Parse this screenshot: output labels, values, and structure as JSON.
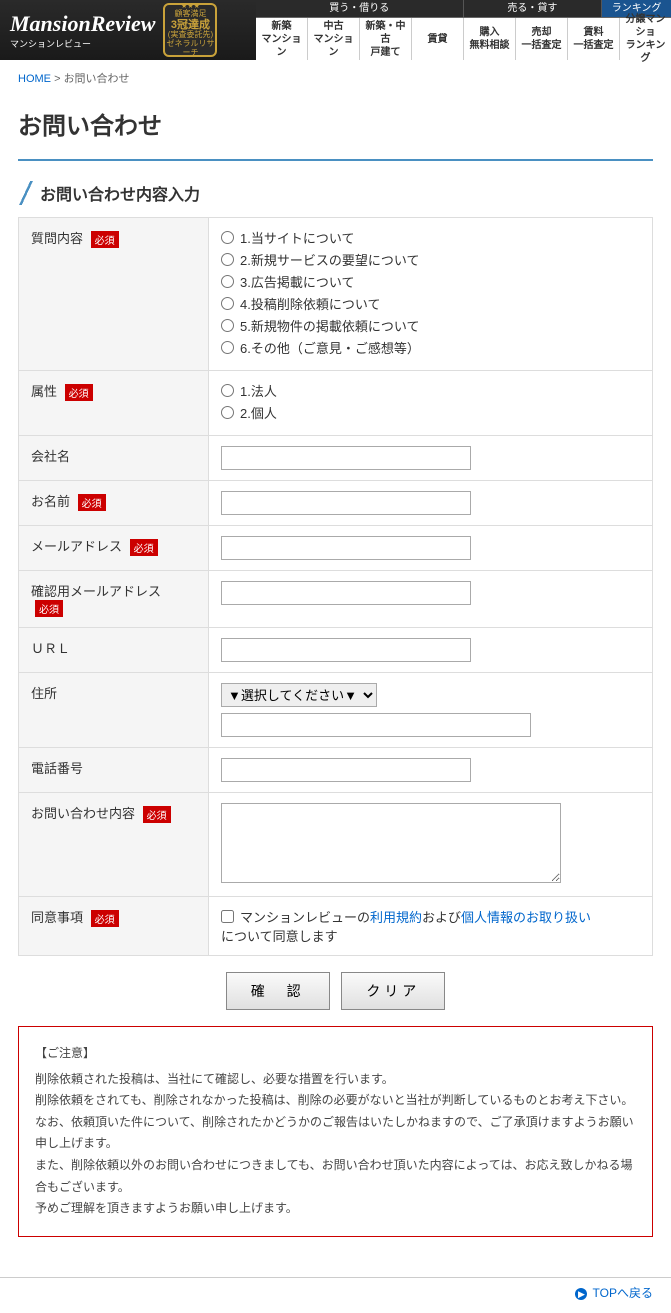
{
  "header": {
    "logo_main": "MansionReview",
    "logo_sub": "マンションレビュー",
    "badge": {
      "stars": "★★★",
      "line1": "顧客満足",
      "main": "3冠達成",
      "line2": "(実査委託先)",
      "line3": "ゼネラルリサーチ"
    }
  },
  "nav": {
    "cats": [
      "買う・借りる",
      "売る・貸す",
      "ランキング"
    ],
    "tabs": [
      "新築\nマンション",
      "中古\nマンション",
      "新築・中古\n戸建て",
      "賃貸",
      "購入\n無料相談",
      "売却\n一括査定",
      "賃料\n一括査定",
      "分譲マンショ\nランキング"
    ]
  },
  "breadcrumb": {
    "home": "HOME",
    "sep": ">",
    "current": "お問い合わせ"
  },
  "page_title": "お問い合わせ",
  "section_title": "お問い合わせ内容入力",
  "required_label": "必須",
  "form": {
    "q_type": {
      "label": "質問内容",
      "required": true,
      "options": [
        "1.当サイトについて",
        "2.新規サービスの要望について",
        "3.広告掲載について",
        "4.投稿削除依頼について",
        "5.新規物件の掲載依頼について",
        "6.その他（ご意見・ご感想等）"
      ]
    },
    "attr": {
      "label": "属性",
      "required": true,
      "options": [
        "1.法人",
        "2.個人"
      ]
    },
    "company": {
      "label": "会社名",
      "required": false
    },
    "name": {
      "label": "お名前",
      "required": true
    },
    "email": {
      "label": "メールアドレス",
      "required": true
    },
    "email_confirm": {
      "label": "確認用メールアドレス",
      "required": true
    },
    "url": {
      "label": "ＵＲＬ",
      "required": false
    },
    "address": {
      "label": "住所",
      "required": false,
      "placeholder": "▼選択してください▼"
    },
    "tel": {
      "label": "電話番号",
      "required": false
    },
    "body": {
      "label": "お問い合わせ内容",
      "required": true
    },
    "agree": {
      "label": "同意事項",
      "required": true,
      "text_pre": "マンションレビューの",
      "link1": "利用規約",
      "text_mid": "および",
      "link2": "個人情報のお取り扱い",
      "text_post": "について同意します"
    }
  },
  "buttons": {
    "confirm": "確　認",
    "clear": "クリア"
  },
  "notice": {
    "title": "【ご注意】",
    "lines": [
      "削除依頼された投稿は、当社にて確認し、必要な措置を行います。",
      "削除依頼をされても、削除されなかった投稿は、削除の必要がないと当社が判断しているものとお考え下さい。",
      "なお、依頼頂いた件について、削除されたかどうかのご報告はいたしかねますので、ご了承頂けますようお願い申し上げます。",
      "また、削除依頼以外のお問い合わせにつきましても、お問い合わせ頂いた内容によっては、お応え致しかねる場合もございます。",
      "予めご理解を頂きますようお願い申し上げます。"
    ]
  },
  "back_top": "TOPへ戻る"
}
